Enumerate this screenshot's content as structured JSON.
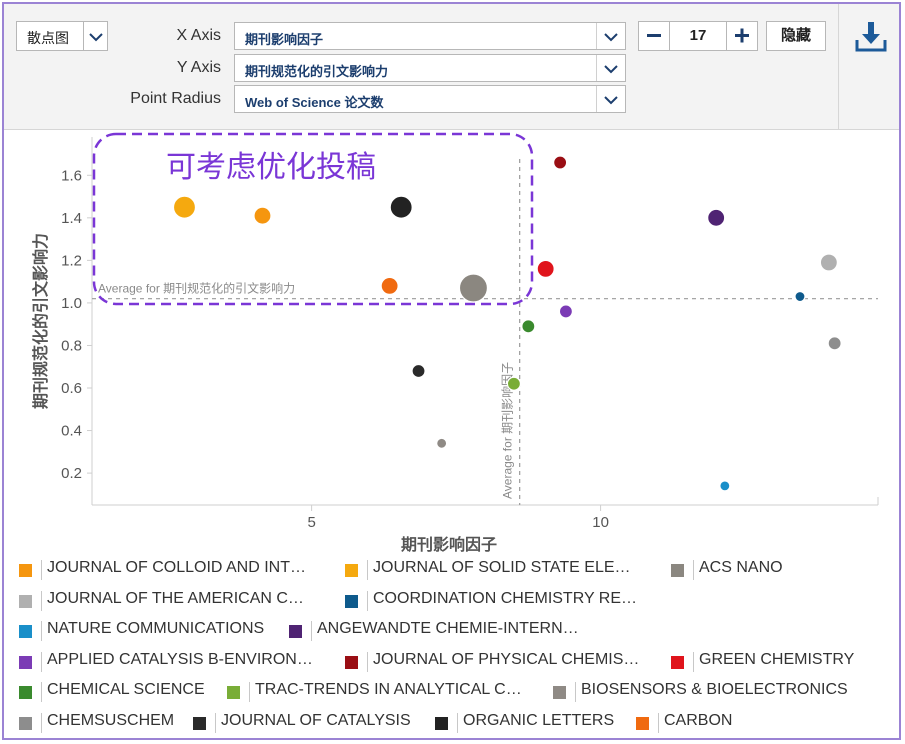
{
  "toolbar": {
    "chart_type_label": "散点图",
    "x_axis_label": "X Axis",
    "y_axis_label": "Y Axis",
    "radius_label": "Point Radius",
    "x_axis_value": "期刊影响因子",
    "y_axis_value": "期刊规范化的引文影响力",
    "radius_value": "Web of Science 论文数",
    "count_value": "17",
    "hide_label": "隐藏"
  },
  "chart_data": {
    "type": "scatter",
    "xlabel": "期刊影响因子",
    "ylabel": "期刊规范化的引文影响力",
    "xlim": [
      1.2,
      14.8
    ],
    "ylim": [
      0.05,
      1.78
    ],
    "xticks": [
      5,
      10
    ],
    "yticks": [
      0.2,
      0.4,
      0.6,
      0.8,
      1.0,
      1.2,
      1.4,
      1.6
    ],
    "grid": false,
    "avg_x": 8.6,
    "avg_y": 1.02,
    "avg_x_label": "Average for 期刊影响因子",
    "avg_y_label": "Average for 期刊规范化的引文影响力",
    "annotation": "可考虑优化投稿",
    "points": [
      {
        "x": 2.8,
        "y": 1.45,
        "color": "#f5a90f",
        "size": "large"
      },
      {
        "x": 4.15,
        "y": 1.41,
        "color": "#f5960f",
        "size": "medium"
      },
      {
        "x": 6.55,
        "y": 1.45,
        "color": "#222222",
        "size": "large"
      },
      {
        "x": 6.35,
        "y": 1.08,
        "color": "#f06a10",
        "size": "medium"
      },
      {
        "x": 7.8,
        "y": 1.07,
        "color": "#8b8780",
        "size": "xlarge"
      },
      {
        "x": 9.3,
        "y": 1.66,
        "color": "#9a0e14",
        "size": "small"
      },
      {
        "x": 9.05,
        "y": 1.16,
        "color": "#e0141c",
        "size": "medium"
      },
      {
        "x": 9.4,
        "y": 0.96,
        "color": "#7b3bb5",
        "size": "small"
      },
      {
        "x": 8.75,
        "y": 0.89,
        "color": "#3a8a2e",
        "size": "small"
      },
      {
        "x": 8.5,
        "y": 0.62,
        "color": "#79ad37",
        "size": "small"
      },
      {
        "x": 6.85,
        "y": 0.68,
        "color": "#2a2a2a",
        "size": "small"
      },
      {
        "x": 7.25,
        "y": 0.34,
        "color": "#8f8a85",
        "size": "tiny"
      },
      {
        "x": 12.0,
        "y": 1.4,
        "color": "#4f2373",
        "size": "medium"
      },
      {
        "x": 13.45,
        "y": 1.03,
        "color": "#0e5a8c",
        "size": "tiny"
      },
      {
        "x": 13.95,
        "y": 1.19,
        "color": "#b0b0b0",
        "size": "medium"
      },
      {
        "x": 14.05,
        "y": 0.81,
        "color": "#8d8d8d",
        "size": "small"
      },
      {
        "x": 12.15,
        "y": 0.14,
        "color": "#1a8fc9",
        "size": "tiny"
      }
    ]
  },
  "legend": [
    {
      "name": "JOURNAL OF COLLOID AND INT…",
      "color": "#f5960f"
    },
    {
      "name": "JOURNAL OF SOLID STATE ELE…",
      "color": "#f5a90f"
    },
    {
      "name": "ACS NANO",
      "color": "#8b8780"
    },
    {
      "name": "JOURNAL OF THE AMERICAN C…",
      "color": "#b0b0b0"
    },
    {
      "name": "COORDINATION CHEMISTRY RE…",
      "color": "#0e5a8c"
    },
    {
      "name": "NATURE COMMUNICATIONS",
      "color": "#1a8fc9"
    },
    {
      "name": "ANGEWANDTE CHEMIE-INTERN…",
      "color": "#4f2373"
    },
    {
      "name": "APPLIED CATALYSIS B-ENVIRON…",
      "color": "#7b3bb5"
    },
    {
      "name": "JOURNAL OF PHYSICAL CHEMIS…",
      "color": "#9a0e14"
    },
    {
      "name": "GREEN CHEMISTRY",
      "color": "#e0141c"
    },
    {
      "name": "CHEMICAL SCIENCE",
      "color": "#3a8a2e"
    },
    {
      "name": "TRAC-TRENDS IN ANALYTICAL C…",
      "color": "#79ad37"
    },
    {
      "name": "BIOSENSORS & BIOELECTRONICS",
      "color": "#8f8a85"
    },
    {
      "name": "CHEMSUSCHEM",
      "color": "#8d8d8d"
    },
    {
      "name": "JOURNAL OF CATALYSIS",
      "color": "#2a2a2a"
    },
    {
      "name": "ORGANIC LETTERS",
      "color": "#222222"
    },
    {
      "name": "CARBON",
      "color": "#f06a10"
    }
  ]
}
